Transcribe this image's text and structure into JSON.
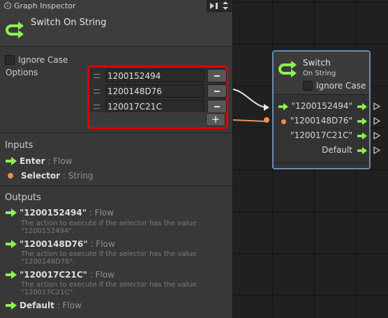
{
  "inspector": {
    "title": "Graph Inspector",
    "node_title": "Switch On String",
    "ignore_case_label": "Ignore Case",
    "options_label": "Options",
    "options": [
      "1200152494",
      "1200148D76",
      "120017C21C"
    ],
    "add_label": "+"
  },
  "inputs": {
    "title": "Inputs",
    "ports": [
      {
        "name": "Enter",
        "type": " : Flow"
      },
      {
        "name": "Selector",
        "type": " : String"
      }
    ]
  },
  "outputs": {
    "title": "Outputs",
    "ports": [
      {
        "name": "\"1200152494\"",
        "type": " : Flow",
        "desc": "The action to execute if the selector has the value \"1200152494\"."
      },
      {
        "name": "\"1200148D76\"",
        "type": " : Flow",
        "desc": "The action to execute if the selector has the value \"1200148D76\"."
      },
      {
        "name": "\"120017C21C\"",
        "type": " : Flow",
        "desc": "The action to execute if the selector has the value \"120017C21C\"."
      },
      {
        "name": "Default",
        "type": " : Flow"
      }
    ]
  },
  "graph_node": {
    "title": "Switch",
    "subtitle": "On String",
    "ignore_case_label": "Ignore Case",
    "ports": [
      "\"1200152494\"",
      "\"1200148D76\"",
      "\"120017C21C\"",
      "Default"
    ]
  },
  "colors": {
    "flow_arrow": "#8ff24b",
    "value_port": "#ea9150",
    "selection_outline": "#e00000",
    "node_highlight": "#6b8db1"
  },
  "icons": {
    "node_icon": "switch-arrows-icon",
    "flow_port": "flow-arrow-icon",
    "value_port": "value-dot-icon"
  }
}
